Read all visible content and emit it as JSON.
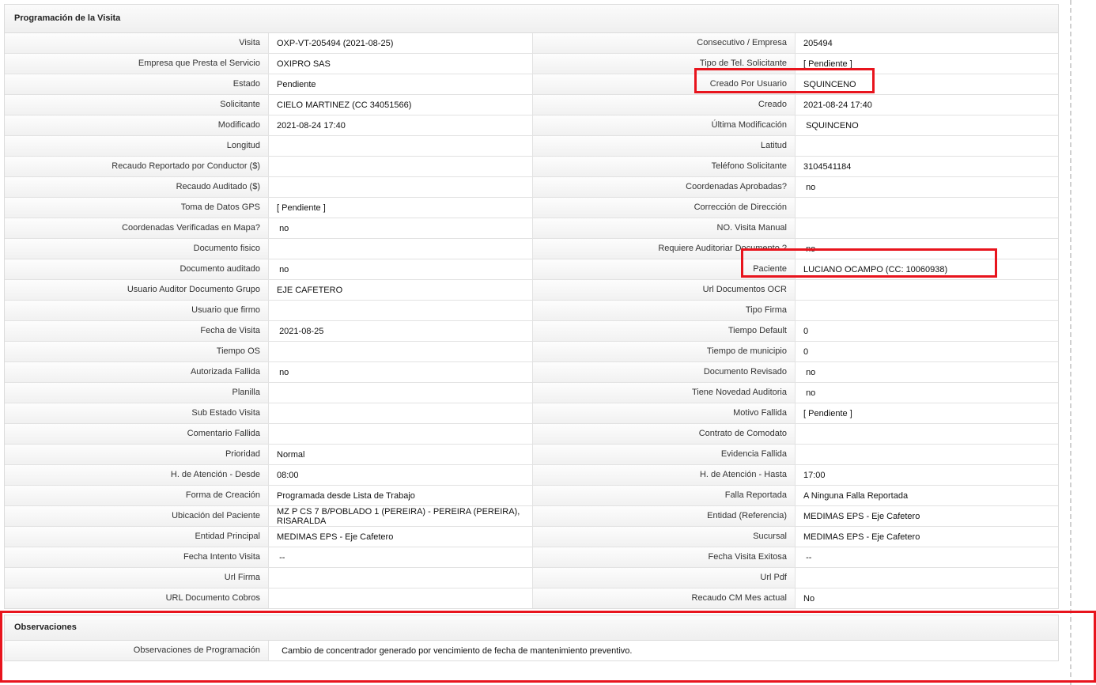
{
  "program_section": {
    "title": "Programación de la Visita",
    "rows": [
      {
        "l1": "Visita",
        "v1": "OXP-VT-205494 (2021-08-25)",
        "l2": "Consecutivo / Empresa",
        "v2": "205494"
      },
      {
        "l1": "Empresa que Presta el Servicio",
        "v1": "OXIPRO SAS",
        "l2": "Tipo de Tel. Solicitante",
        "v2": "[ Pendiente ]"
      },
      {
        "l1": "Estado",
        "v1": "Pendiente",
        "l2": "Creado Por Usuario",
        "v2": "SQUINCENO"
      },
      {
        "l1": "Solicitante",
        "v1": "CIELO MARTINEZ (CC 34051566)",
        "l2": "Creado",
        "v2": "2021-08-24 17:40"
      },
      {
        "l1": "Modificado",
        "v1": "2021-08-24 17:40",
        "l2": "Última Modificación",
        "v2": " SQUINCENO"
      },
      {
        "l1": "Longitud",
        "v1": "",
        "l2": "Latitud",
        "v2": ""
      },
      {
        "l1": "Recaudo Reportado por Conductor ($)",
        "v1": "",
        "l2": "Teléfono Solicitante",
        "v2": "3104541184"
      },
      {
        "l1": "Recaudo Auditado ($)",
        "v1": "",
        "l2": "Coordenadas Aprobadas?",
        "v2": " no"
      },
      {
        "l1": "Toma de Datos GPS",
        "v1": "[ Pendiente ]",
        "l2": "Corrección de Dirección",
        "v2": ""
      },
      {
        "l1": "Coordenadas Verificadas en Mapa?",
        "v1": " no",
        "l2": "NO. Visita Manual",
        "v2": ""
      },
      {
        "l1": "Documento fisico",
        "v1": "",
        "l2": "Requiere Auditoriar Documento ?",
        "v2": " no"
      },
      {
        "l1": "Documento auditado",
        "v1": " no",
        "l2": "Paciente",
        "v2": "LUCIANO OCAMPO (CC: 10060938)"
      },
      {
        "l1": "Usuario Auditor Documento Grupo",
        "v1": "EJE CAFETERO",
        "l2": "Url Documentos OCR",
        "v2": ""
      },
      {
        "l1": "Usuario que firmo",
        "v1": "",
        "l2": "Tipo Firma",
        "v2": ""
      },
      {
        "l1": "Fecha de Visita",
        "v1": " 2021-08-25",
        "l2": "Tiempo Default",
        "v2": "0"
      },
      {
        "l1": "Tiempo OS",
        "v1": "",
        "l2": "Tiempo de municipio",
        "v2": "0"
      },
      {
        "l1": "Autorizada Fallida",
        "v1": " no",
        "l2": "Documento Revisado",
        "v2": " no"
      },
      {
        "l1": "Planilla",
        "v1": "",
        "l2": "Tiene Novedad Auditoria",
        "v2": " no"
      },
      {
        "l1": "Sub Estado Visita",
        "v1": "",
        "l2": "Motivo Fallida",
        "v2": "[ Pendiente ]"
      },
      {
        "l1": "Comentario Fallida",
        "v1": "",
        "l2": "Contrato de Comodato",
        "v2": ""
      },
      {
        "l1": "Prioridad",
        "v1": "Normal",
        "l2": "Evidencia Fallida",
        "v2": ""
      },
      {
        "l1": "H. de Atención - Desde",
        "v1": "08:00",
        "l2": "H. de Atención - Hasta",
        "v2": "17:00"
      },
      {
        "l1": "Forma de Creación",
        "v1": "Programada desde Lista de Trabajo",
        "l2": "Falla Reportada",
        "v2": "A Ninguna Falla Reportada"
      },
      {
        "l1": "Ubicación del Paciente",
        "v1": "MZ P CS 7 B/POBLADO 1 (PEREIRA) - PEREIRA (PEREIRA), RISARALDA",
        "l2": "Entidad (Referencia)",
        "v2": "MEDIMAS EPS - Eje Cafetero"
      },
      {
        "l1": "Entidad Principal",
        "v1": "MEDIMAS EPS - Eje Cafetero",
        "l2": "Sucursal",
        "v2": "MEDIMAS EPS - Eje Cafetero"
      },
      {
        "l1": "Fecha Intento Visita",
        "v1": " --",
        "l2": "Fecha Visita Exitosa",
        "v2": " --"
      },
      {
        "l1": "Url Firma",
        "v1": "",
        "l2": "Url Pdf",
        "v2": ""
      },
      {
        "l1": "URL Documento Cobros",
        "v1": "",
        "l2": "Recaudo CM Mes actual",
        "v2": "No"
      }
    ]
  },
  "observaciones_section": {
    "title": "Observaciones",
    "label": "Observaciones de Programación",
    "value": "  Cambio de concentrador generado por vencimiento de fecha de mantenimiento preventivo."
  },
  "colors": {
    "highlight": "#e8141d",
    "border": "#dcdcdc"
  }
}
